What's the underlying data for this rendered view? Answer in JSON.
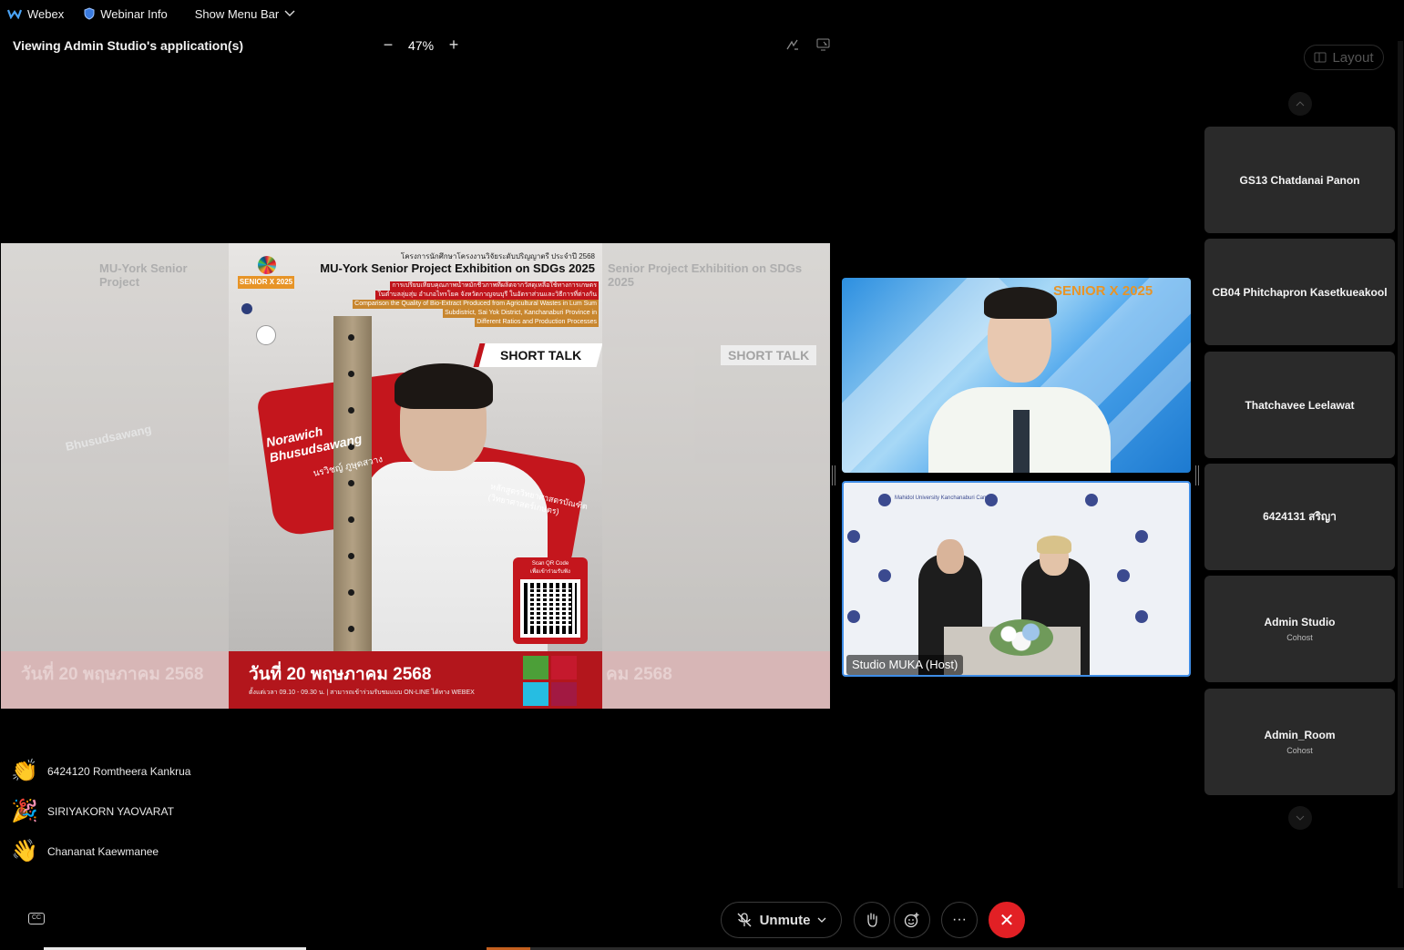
{
  "topbar": {
    "app_name": "Webex",
    "webinar_info": "Webinar Info",
    "show_menu_bar": "Show Menu Bar"
  },
  "sharing": {
    "title": "Viewing Admin Studio's application(s)",
    "zoom_level": "47%"
  },
  "layout_button": "Layout",
  "poster": {
    "header_th": "โครงการนักศึกษาโครงงานวิจัยระดับปริญญาตรี ประจำปี 2568",
    "title": "MU-York Senior Project Exhibition on SDGs 2025",
    "topic_th_1": "การเปรียบเทียบคุณภาพน้ำหมักชีวภาพที่ผลิตจากวัสดุเหลือใช้ทางการเกษตร",
    "topic_th_2": "ในตำบลลุ่มสุ่ม อำเภอไทรโยค จังหวัดกาญจนบุรี ในอัตราส่วนและวิธีการที่ต่างกัน",
    "topic_en_1": "Comparison the Quality of Bio-Extract Produced from Agricultural Wastes in Lum Sum",
    "topic_en_2": "Subdistrict, Sai Yok District, Kanchanaburi Province in",
    "topic_en_3": "Different Ratios and Production Processes",
    "badge": "SHORT TALK",
    "name_en_1": "Norawich",
    "name_en_2": "Bhusudsawang",
    "name_th": "นรวิชญ์ ภูษุดสวาง",
    "major_1": "หลักสูตรวิทยาศาสตรบัณฑิต",
    "major_2": "(วิทยาศาสตร์เกษตร)",
    "qr_label_1": "Scan QR Code",
    "qr_label_2": "เพื่อเข้าร่วมรับฟัง",
    "date": "วันที่ 20 พฤษภาคม 2568",
    "time": "ตั้งแต่เวลา 09.10 - 09.30 น. | สามารถเข้าร่วมรับชมแบบ ON-LINE ได้ทาง WEBEX",
    "logo_brand": "SENIOR X 2025",
    "side_title": "MU-York Senior Project",
    "side_date_left": "วันที่ 20 พฤษภาคม 2568",
    "side_date_right": "คม 2568",
    "side_badge": "SHORT TALK",
    "side_title_right": "Senior Project Exhibition on SDGs 2025"
  },
  "videos": {
    "speaker_brand": "SENIOR X 2025",
    "host_label": "Studio MUKA (Host)",
    "backdrop_label": "Mahidol University Kanchanaburi Campus"
  },
  "participants": [
    {
      "name": "GS13 Chatdanai Panon",
      "role": ""
    },
    {
      "name": "CB04 Phitchapron Kasetkueakool",
      "role": ""
    },
    {
      "name": "Thatchavee Leelawat",
      "role": ""
    },
    {
      "name": "6424131 สริญา",
      "role": ""
    },
    {
      "name": "Admin Studio",
      "role": "Cohost"
    },
    {
      "name": "Admin_Room",
      "role": "Cohost"
    }
  ],
  "reactions": [
    {
      "name": "6424120 Romtheera Kankrua",
      "emoji": "👏"
    },
    {
      "name": "SIRIYAKORN YAOVARAT",
      "emoji": "🎉"
    },
    {
      "name": "Chananat Kaewmanee",
      "emoji": "👋"
    }
  ],
  "controls": {
    "cc": "CC",
    "unmute": "Unmute",
    "more": "···",
    "end": "✕"
  },
  "colors": {
    "end_button": "#e22025",
    "active_border": "#3f8de6",
    "poster_red": "#b3161c"
  }
}
